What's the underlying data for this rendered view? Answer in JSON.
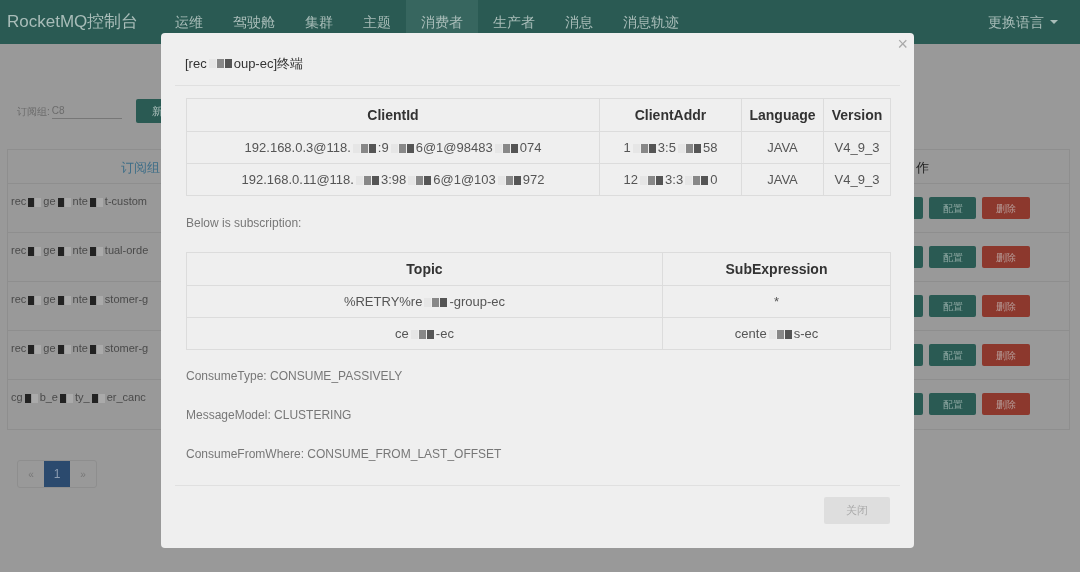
{
  "navbar": {
    "brand": "RocketMQ控制台",
    "items": [
      {
        "label": "运维",
        "selected": false
      },
      {
        "label": "驾驶舱",
        "selected": false
      },
      {
        "label": "集群",
        "selected": false
      },
      {
        "label": "主题",
        "selected": false
      },
      {
        "label": "消费者",
        "selected": true
      },
      {
        "label": "生产者",
        "selected": false
      },
      {
        "label": "消息",
        "selected": false
      },
      {
        "label": "消息轨迹",
        "selected": false
      }
    ],
    "language_menu": "更换语言"
  },
  "filter": {
    "label": "订阅组:",
    "value": "C8",
    "add_button": "新"
  },
  "group_table": {
    "columns": [
      "订阅组",
      "作"
    ],
    "rows": [
      {
        "group_parts": [
          "rec",
          "ge",
          "nte",
          "t-custom"
        ],
        "buttons": [
          "配置",
          "删除"
        ]
      },
      {
        "group_parts": [
          "rec",
          "ge",
          "nte",
          "tual-orde"
        ],
        "buttons": [
          "配置",
          "删除"
        ]
      },
      {
        "group_parts": [
          "rec",
          "ge",
          "nte",
          "stomer-g"
        ],
        "buttons": [
          "配置",
          "删除"
        ]
      },
      {
        "group_parts": [
          "rec",
          "ge",
          "nte",
          "stomer-g"
        ],
        "buttons": [
          "配置",
          "删除"
        ]
      },
      {
        "group_parts": [
          "cg",
          "b_e",
          "ty_",
          "er_canc"
        ],
        "buttons": [
          "配置",
          "删除"
        ]
      }
    ]
  },
  "pagination": [
    {
      "label": "«",
      "selected": false
    },
    {
      "label": "1",
      "selected": true
    },
    {
      "label": "»",
      "selected": false
    }
  ],
  "dialog": {
    "title_parts": [
      "[rec",
      "oup-ec]终端"
    ],
    "close": "×",
    "client_table": {
      "columns": [
        "ClientId",
        "ClientAddr",
        "Language",
        "Version"
      ],
      "rows": [
        {
          "client_id_parts": [
            "192.168.0.3@118.",
            ":9",
            "6@1@98483",
            "074"
          ],
          "client_addr_parts": [
            "1",
            "3:5",
            "58"
          ],
          "language": "JAVA",
          "version": "V4_9_3"
        },
        {
          "client_id_parts": [
            "192.168.0.11@118.",
            "3:98",
            "6@1@103",
            "972"
          ],
          "client_addr_parts": [
            "12",
            "3:3",
            "0"
          ],
          "language": "JAVA",
          "version": "V4_9_3"
        }
      ]
    },
    "subscription_intro": "Below is subscription:",
    "subscription_table": {
      "columns": [
        "Topic",
        "SubExpression"
      ],
      "rows": [
        {
          "topic_parts": [
            "%RETRY%re",
            "-group-ec"
          ],
          "sub_expression_parts": [
            "*"
          ]
        },
        {
          "topic_parts": [
            "ce",
            "-ec"
          ],
          "sub_expression_parts": [
            "cente",
            "s-ec"
          ]
        }
      ]
    },
    "details": [
      "ConsumeType: CONSUME_PASSIVELY",
      "MessageModel: CLUSTERING",
      "ConsumeFromWhere: CONSUME_FROM_LAST_OFFSET"
    ],
    "close_button": "关闭"
  }
}
